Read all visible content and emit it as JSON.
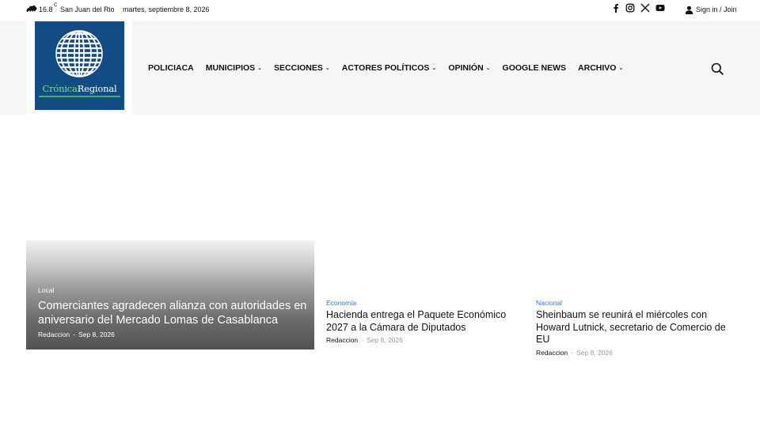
{
  "topbar": {
    "temperature": "16.8",
    "unit": "C",
    "city": "San Juan del Rio",
    "date": "martes, septiembre 8, 2026",
    "social_icons": [
      "facebook-icon",
      "instagram-icon",
      "x-icon",
      "youtube-icon"
    ],
    "signin_label": "Sign in / Join"
  },
  "logo": {
    "name_part1": "Crónica",
    "name_part2": "Regional",
    "bg_color": "#124c84",
    "accent_color": "#7ee07a"
  },
  "nav": {
    "items": [
      {
        "label": "POLICIACA",
        "dropdown": false
      },
      {
        "label": "MUNICIPIOS",
        "dropdown": true
      },
      {
        "label": "SECCIONES",
        "dropdown": true
      },
      {
        "label": "ACTORES POLÍTICOS",
        "dropdown": true
      },
      {
        "label": "OPINIÓN",
        "dropdown": true
      },
      {
        "label": "GOOGLE NEWS",
        "dropdown": false
      },
      {
        "label": "ARCHIVO",
        "dropdown": true
      }
    ],
    "search_icon": "search-icon"
  },
  "feature": {
    "category": "Local",
    "title": "Comerciantes agradecen alianza con autoridades en aniversario del Mercado Lomas de Casablanca",
    "author": "Redaccion",
    "separator": "-",
    "date": "Sep 8, 2026"
  },
  "articles": [
    {
      "category": "Economía",
      "title": "Hacienda entrega el Paquete Económico 2027 a la Cámara de Diputados",
      "author": "Redaccion",
      "separator": "-",
      "date": "Sep 8, 2026"
    },
    {
      "category": "Nacional",
      "title": "Sheinbaum se reunirá el miércoles con Howard Lutnick, secretario de Comercio de EU",
      "author": "Redaccion",
      "separator": "-",
      "date": "Sep 8, 2026"
    }
  ],
  "colors": {
    "category_link": "#3478c8",
    "meta_gray": "#999999",
    "header_bg": "#f6f6f6"
  }
}
